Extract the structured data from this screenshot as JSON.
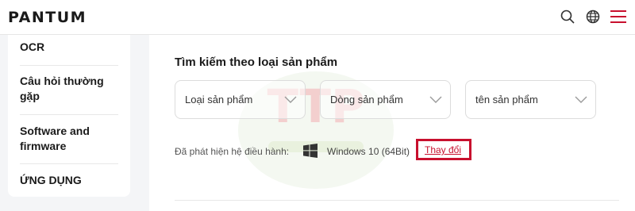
{
  "brand": {
    "logo_text": "PANTUM"
  },
  "header": {
    "icons": [
      "search-icon",
      "globe-icon",
      "menu-icon"
    ],
    "accent_color": "#c8102e"
  },
  "sidebar": {
    "items": [
      {
        "label": "OCR"
      },
      {
        "label": "Câu hỏi thường gặp"
      },
      {
        "label": "Software and firmware"
      },
      {
        "label": "ỨNG DỤNG"
      }
    ]
  },
  "main": {
    "section_title": "Tìm kiếm theo loại sản phẩm",
    "selects": [
      {
        "value": "Loại sản phẩm"
      },
      {
        "value": "Dòng sản phẩm"
      },
      {
        "value": "tên sản phẩm"
      }
    ],
    "os": {
      "label": "Đã phát hiện hệ điều hành:",
      "icon": "windows-icon",
      "value": "Windows 10 (64Bit)",
      "change_label": "Thay đổi"
    },
    "watermark": {
      "text": "TTP"
    }
  }
}
